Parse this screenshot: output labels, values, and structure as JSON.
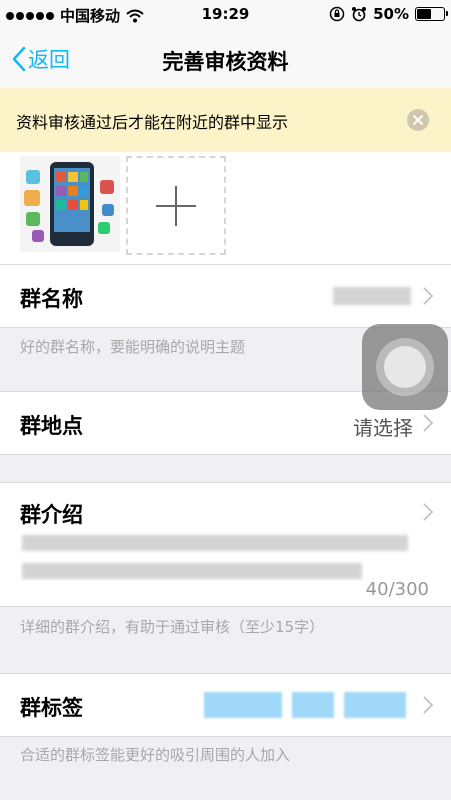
{
  "statusbar": {
    "carrier": "中国移动",
    "time": "19:29",
    "battery": "50%",
    "battery_level": 0.5
  },
  "navbar": {
    "back_label": "返回",
    "title": "完善审核资料"
  },
  "notice": {
    "text": "资料审核通过后才能在附近的群中显示",
    "close_icon": "close-circle-icon"
  },
  "photos": {
    "add_icon": "plus-icon"
  },
  "group_name": {
    "label": "群名称",
    "hint": "好的群名称，要能明确的说明主题"
  },
  "location": {
    "label": "群地点",
    "value": "请选择"
  },
  "intro": {
    "label": "群介绍",
    "counter": "40/300",
    "hint": "详细的群介绍，有助于通过审核（至少15字）"
  },
  "tags": {
    "label": "群标签",
    "hint": "合适的群标签能更好的吸引周围的人加入"
  },
  "colors": {
    "accent": "#12b7f5",
    "notice_bg": "#fdf3c8",
    "page_bg": "#efeff4"
  }
}
